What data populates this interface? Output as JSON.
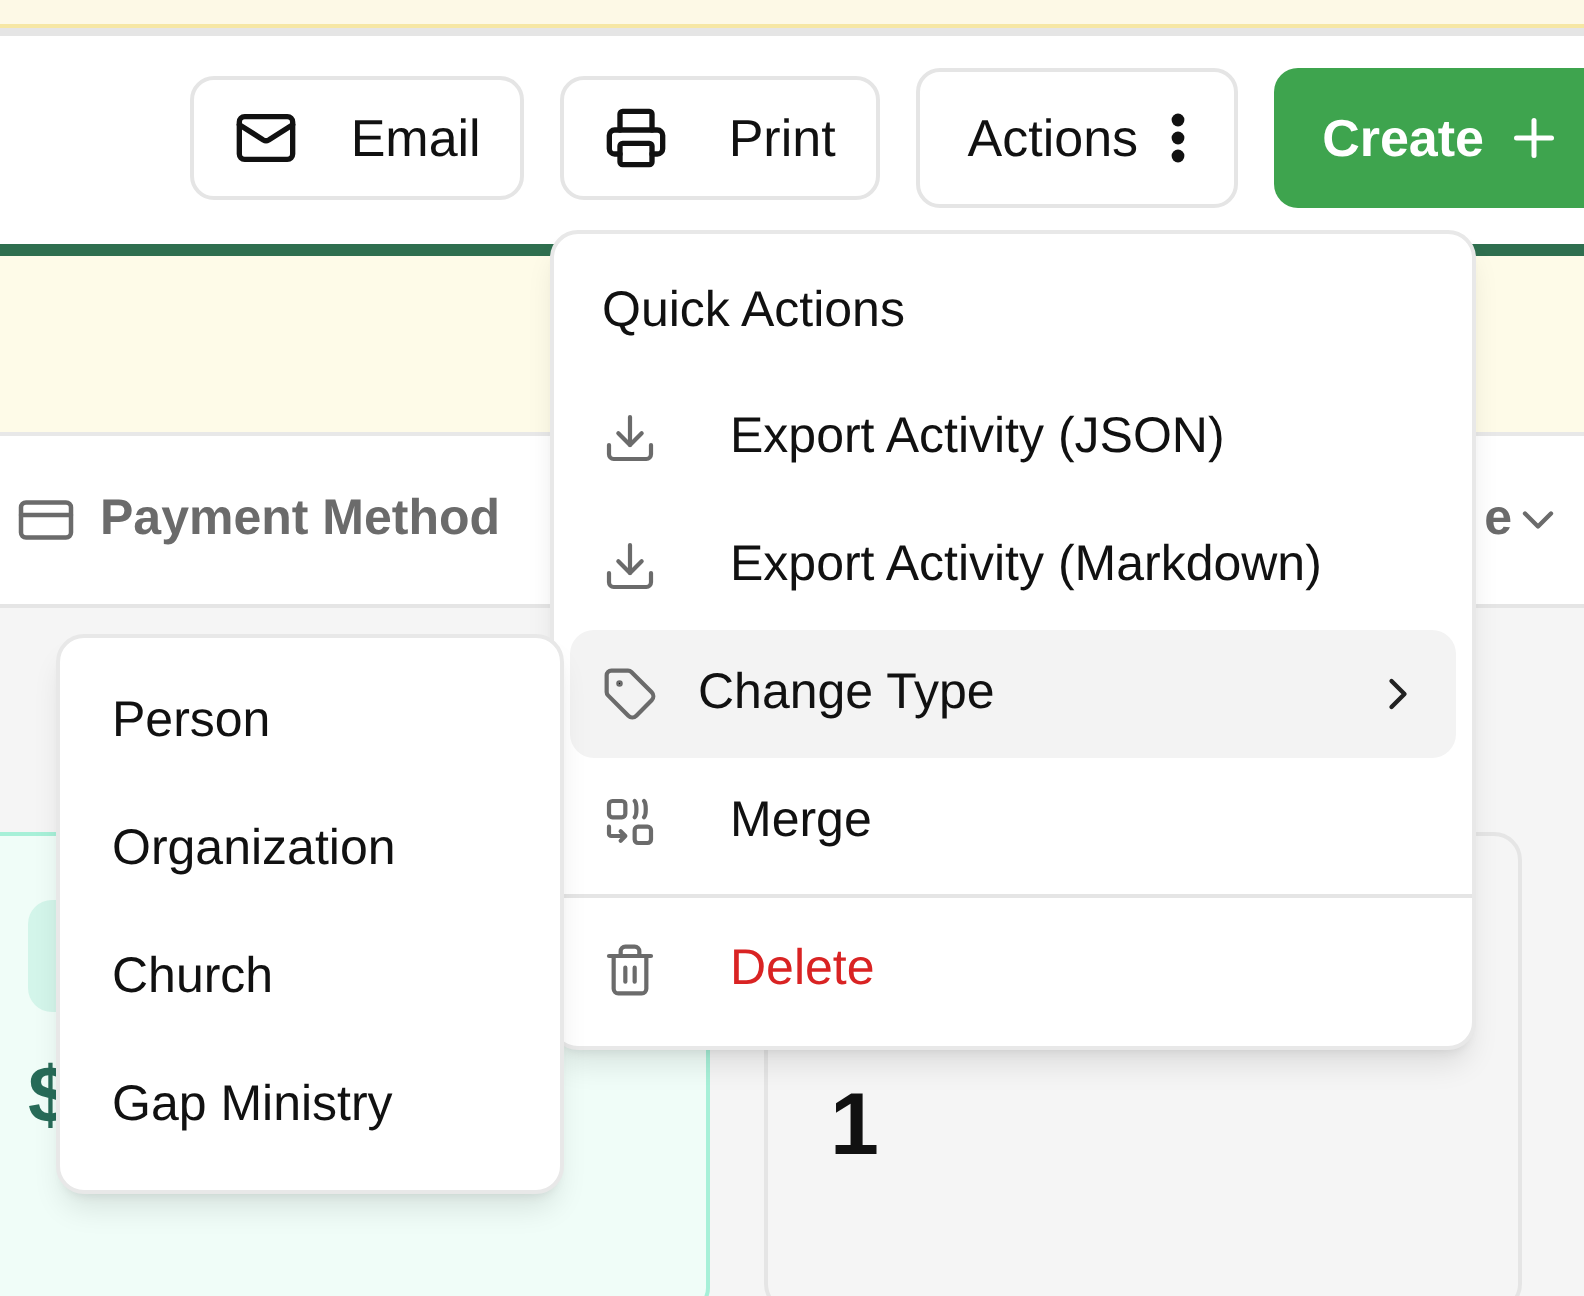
{
  "toolbar": {
    "buttons": [
      {
        "label": "Email",
        "kind": "email"
      },
      {
        "label": "Print",
        "kind": "print"
      },
      {
        "label": "Actions",
        "kind": "more"
      },
      {
        "label": "Create",
        "kind": "create"
      }
    ]
  },
  "tabs": [
    {
      "label": "Payment Method",
      "kind": "card"
    },
    {
      "label": "e",
      "kind": "dropdown"
    }
  ],
  "cards": [
    {
      "kind": "teal",
      "value": "$"
    },
    {
      "kind": "gray",
      "value": "1"
    }
  ],
  "actions_menu": {
    "title": "Quick Actions",
    "items": [
      {
        "label": "Export Activity (JSON)",
        "kind": "export",
        "selected": false
      },
      {
        "label": "Export Activity (Markdown)",
        "kind": "export",
        "selected": false
      },
      {
        "label": "Change Type",
        "kind": "submenu",
        "selected": true
      },
      {
        "label": "Merge",
        "kind": "merge",
        "selected": false
      },
      {
        "label": "Delete",
        "kind": "delete",
        "selected": false
      }
    ]
  },
  "type_submenu": {
    "items": [
      {
        "label": "Person"
      },
      {
        "label": "Organization"
      },
      {
        "label": "Church"
      },
      {
        "label": "Gap Ministry"
      }
    ]
  }
}
